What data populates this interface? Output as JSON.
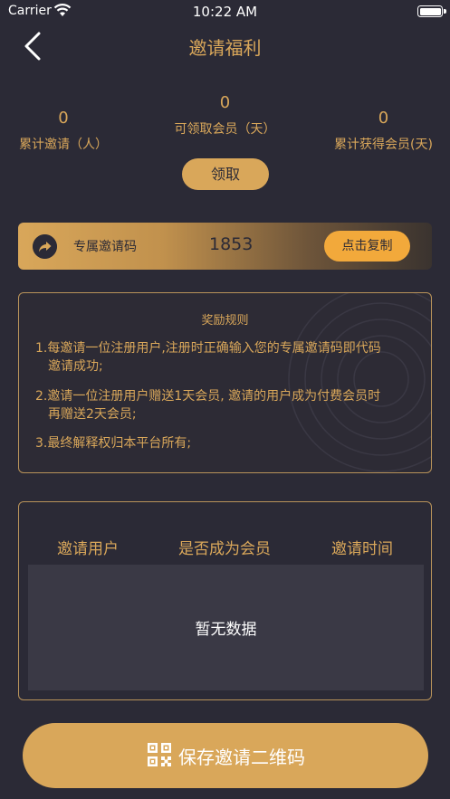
{
  "status_bar": {
    "carrier": "Carrier",
    "time": "10:22 AM"
  },
  "nav": {
    "title": "邀请福利"
  },
  "stats": {
    "total_invites": {
      "value": "0",
      "label": "累计邀请（人）"
    },
    "claimable_member": {
      "value": "0",
      "label": "可领取会员（天）"
    },
    "total_member_earned": {
      "value": "0",
      "label": "累计获得会员(天)"
    }
  },
  "claim_button": "领取",
  "invite_code": {
    "label": "专属邀请码",
    "value": "1853",
    "copy_label": "点击复制"
  },
  "rules": {
    "title": "奖励规则",
    "items": [
      {
        "line1": "1.每邀请一位注册用户,注册时正确输入您的专属邀请码即代码",
        "line2": "邀请成功;"
      },
      {
        "line1": "2.邀请一位注册用户赠送1天会员, 邀请的用户成为付费会员时",
        "line2": "再赠送2天会员;"
      },
      {
        "line1": "3.最终解释权归本平台所有;"
      }
    ]
  },
  "records": {
    "columns": [
      "邀请用户",
      "是否成为会员",
      "邀请时间"
    ],
    "empty_text": "暂无数据"
  },
  "save_qr_button": "保存邀请二维码",
  "colors": {
    "background": "#2b2a36",
    "accent": "#d9a75a",
    "button": "#f2a93b"
  }
}
